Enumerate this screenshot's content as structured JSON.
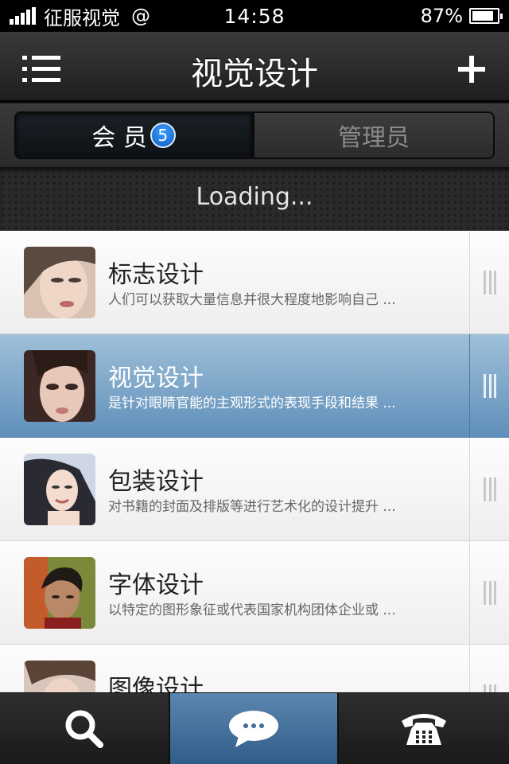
{
  "status_bar": {
    "carrier": "征服视觉",
    "network": "@",
    "time": "14:58",
    "battery": "87%",
    "battery_level": 0.87
  },
  "navbar": {
    "title": "视觉设计",
    "menu_icon": "list-menu-icon",
    "add_icon": "plus-icon"
  },
  "segments": [
    {
      "label": "会 员",
      "badge": "5",
      "selected": true
    },
    {
      "label": "管理员",
      "selected": false
    }
  ],
  "loading": "Loading...",
  "list": [
    {
      "title": "标志设计",
      "desc": "人们可以获取大量信息并很大程度地影响自己 ...",
      "selected": false
    },
    {
      "title": "视觉设计",
      "desc": "是针对眼睛官能的主观形式的表现手段和结果 ...",
      "selected": true
    },
    {
      "title": "包装设计",
      "desc": "对书籍的封面及排版等进行艺术化的设计提升 ...",
      "selected": false
    },
    {
      "title": "字体设计",
      "desc": "以特定的图形象征或代表国家机构团体企业或 ...",
      "selected": false
    },
    {
      "title": "图像设计",
      "desc": "",
      "selected": false
    }
  ],
  "tabbar": [
    {
      "icon": "search-icon",
      "selected": false
    },
    {
      "icon": "chat-bubble-icon",
      "selected": true
    },
    {
      "icon": "telephone-icon",
      "selected": false
    }
  ]
}
